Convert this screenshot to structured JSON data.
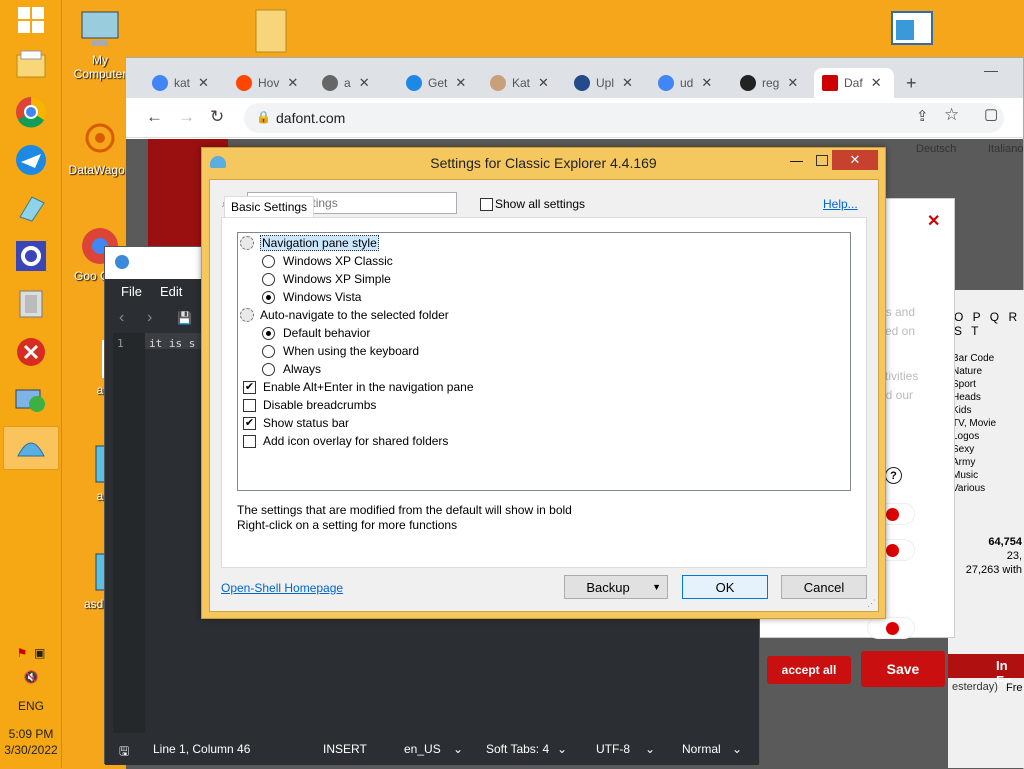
{
  "desktop": {
    "icons": [
      {
        "label": "My Computer"
      },
      {
        "label": "DataWagon"
      },
      {
        "label": "Goo Chro"
      },
      {
        "label": "a"
      },
      {
        "label": "a"
      },
      {
        "label": "asdas"
      }
    ]
  },
  "taskbar": {
    "language": "ENG",
    "time": "5:09 PM",
    "date": "3/30/2022"
  },
  "browser": {
    "tabs": [
      {
        "label": "kat"
      },
      {
        "label": "Hov"
      },
      {
        "label": "a"
      },
      {
        "label": "Get"
      },
      {
        "label": "Kat"
      },
      {
        "label": "Upl"
      },
      {
        "label": "ud"
      },
      {
        "label": "reg"
      },
      {
        "label": "Daf"
      }
    ],
    "url": "dafont.com",
    "page": {
      "langs": [
        "Deutsch",
        "Italiano"
      ],
      "alphabet": "O P Q R S T",
      "categories": [
        "Bar Code",
        "Nature",
        "Sport",
        "Heads",
        "Kids",
        "TV, Movie",
        "Logos",
        "Sexy",
        "Army",
        "Music",
        "Various"
      ],
      "stats": [
        "64,754",
        "23,",
        "27,263 with"
      ],
      "cookie_text": [
        "es and",
        "sed on",
        "ctivities",
        "nd our"
      ],
      "accept_all": "accept all",
      "save": "Save",
      "in_fa": "In Fa",
      "yesterday": "esterday)",
      "fre": "Fre"
    }
  },
  "editor": {
    "menu": [
      "File",
      "Edit"
    ],
    "line_number": "1",
    "code": "it is s",
    "status": {
      "position": "Line 1, Column 46",
      "mode": "INSERT",
      "locale": "en_US",
      "tabs": "Soft Tabs: 4",
      "encoding": "UTF-8",
      "view": "Normal"
    }
  },
  "dialog": {
    "title": "Settings for Classic Explorer 4.4.169",
    "search_placeholder": "Search Settings",
    "show_all_label": "Show all settings",
    "help_label": "Help...",
    "tab_label": "Basic Settings",
    "settings": [
      {
        "type": "group",
        "label": "Navigation pane style"
      },
      {
        "type": "radio",
        "label": "Windows XP Classic",
        "checked": false
      },
      {
        "type": "radio",
        "label": "Windows XP Simple",
        "checked": false
      },
      {
        "type": "radio",
        "label": "Windows Vista",
        "checked": true
      },
      {
        "type": "group",
        "label": "Auto-navigate to the selected folder"
      },
      {
        "type": "radio",
        "label": "Default behavior",
        "checked": true
      },
      {
        "type": "radio",
        "label": "When using the keyboard",
        "checked": false
      },
      {
        "type": "radio",
        "label": "Always",
        "checked": false
      },
      {
        "type": "check",
        "label": "Enable Alt+Enter in the navigation pane",
        "checked": true
      },
      {
        "type": "check",
        "label": "Disable breadcrumbs",
        "checked": false
      },
      {
        "type": "check",
        "label": "Show status bar",
        "checked": true
      },
      {
        "type": "check",
        "label": "Add icon overlay for shared folders",
        "checked": false
      }
    ],
    "note1": "The settings that are modified from the default will show in bold",
    "note2": "Right-click on a setting for more functions",
    "homepage_link": "Open-Shell Homepage",
    "backup_label": "Backup",
    "ok_label": "OK",
    "cancel_label": "Cancel"
  }
}
